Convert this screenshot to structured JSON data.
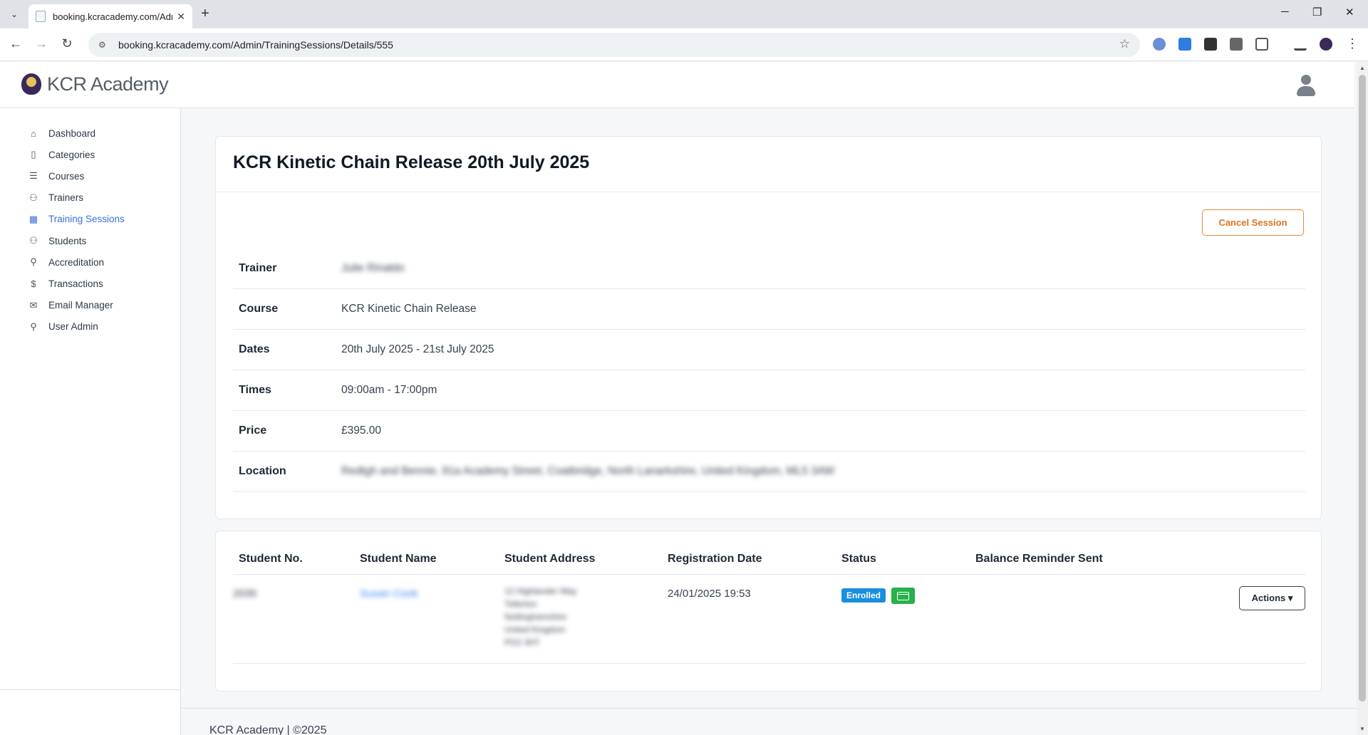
{
  "browser": {
    "tab_title": "booking.kcracademy.com/Adm",
    "url": "booking.kcracademy.com/Admin/TrainingSessions/Details/555"
  },
  "app": {
    "brand": "KCR Academy",
    "footer": "KCR Academy | ©2025"
  },
  "sidebar": {
    "items": [
      {
        "label": "Dashboard",
        "icon": "home-icon"
      },
      {
        "label": "Categories",
        "icon": "clipboard-icon"
      },
      {
        "label": "Courses",
        "icon": "list-icon"
      },
      {
        "label": "Trainers",
        "icon": "users-icon"
      },
      {
        "label": "Training Sessions",
        "icon": "calendar-icon",
        "active": true
      },
      {
        "label": "Students",
        "icon": "users-icon"
      },
      {
        "label": "Accreditation",
        "icon": "award-icon"
      },
      {
        "label": "Transactions",
        "icon": "dollar-icon"
      },
      {
        "label": "Email Manager",
        "icon": "mail-icon"
      },
      {
        "label": "User Admin",
        "icon": "user-icon"
      }
    ]
  },
  "session": {
    "title": "KCR Kinetic Chain Release 20th July 2025",
    "cancel_label": "Cancel Session",
    "details": [
      {
        "label": "Trainer",
        "value": "Julie Rinaldo",
        "blurred": true
      },
      {
        "label": "Course",
        "value": "KCR Kinetic Chain Release"
      },
      {
        "label": "Dates",
        "value": "20th July 2025 - 21st July 2025"
      },
      {
        "label": "Times",
        "value": "09:00am - 17:00pm"
      },
      {
        "label": "Price",
        "value": "£395.00"
      },
      {
        "label": "Location",
        "value": "Redtgh and Bennie, 91a Academy Street, Coatbridge, North Lanarkshire, United Kingdom, ML5 3AW",
        "blurred": true
      }
    ]
  },
  "students": {
    "headers": {
      "no": "Student No.",
      "name": "Student Name",
      "address": "Student Address",
      "reg_date": "Registration Date",
      "status": "Status",
      "reminder": "Balance Reminder Sent"
    },
    "rows": [
      {
        "no": "2035",
        "name": "Susan Cook",
        "address": [
          "12 Highlander Way",
          "Tollerton",
          "Nottinghamshire",
          "United Kingdom",
          "PO2 3HT"
        ],
        "reg_date": "24/01/2025 19:53",
        "status": "Enrolled",
        "actions_label": "Actions ▾"
      }
    ]
  },
  "colors": {
    "accent": "#3b6fd8",
    "cancel": "#d9741c",
    "enrolled": "#1a8fe0",
    "paid": "#27b14a"
  }
}
